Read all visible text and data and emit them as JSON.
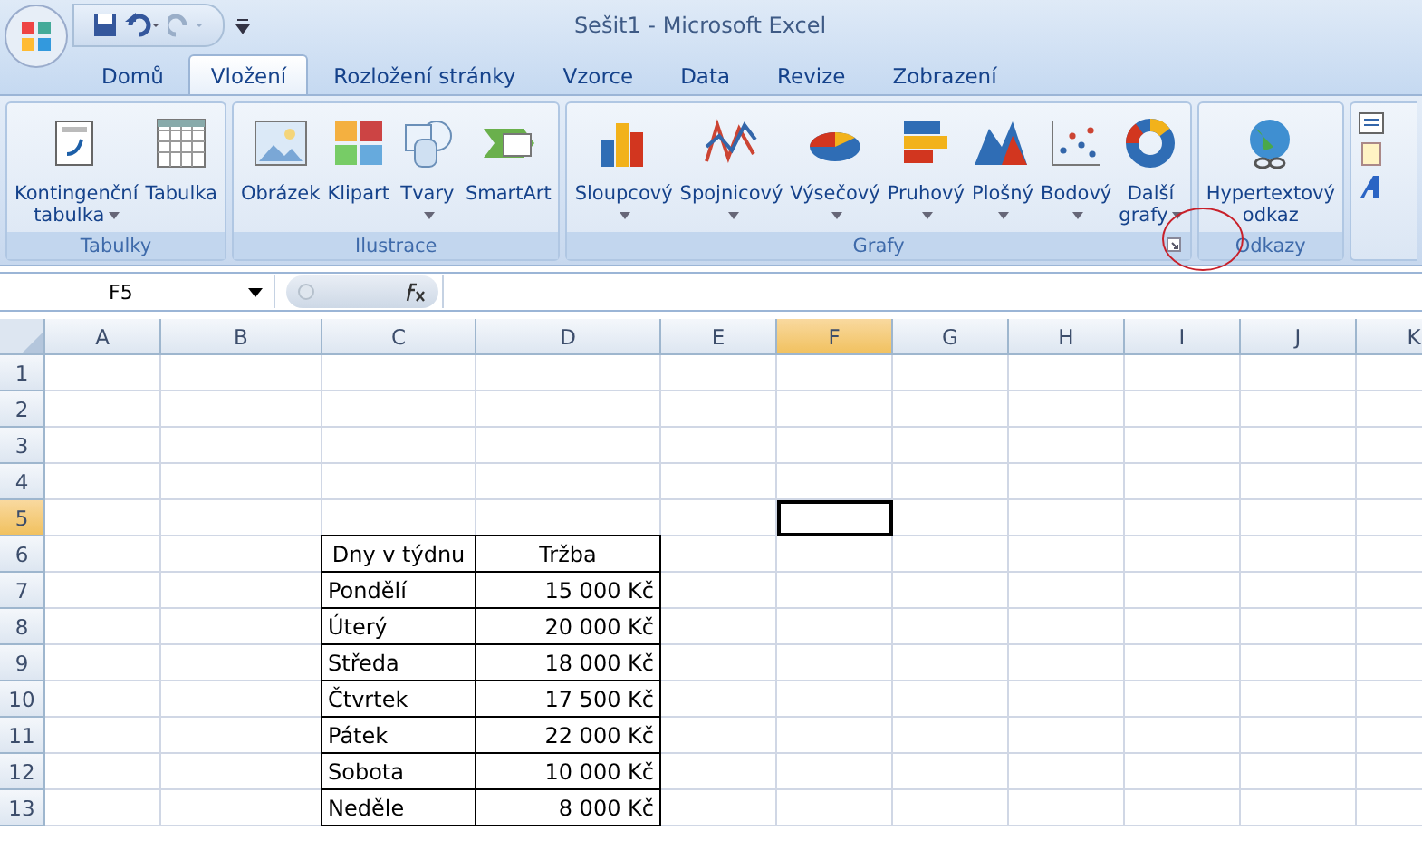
{
  "window": {
    "title": "Sešit1 - Microsoft Excel"
  },
  "tabs": [
    {
      "label": "Domů",
      "selected": false
    },
    {
      "label": "Vložení",
      "selected": true
    },
    {
      "label": "Rozložení stránky",
      "selected": false
    },
    {
      "label": "Vzorce",
      "selected": false
    },
    {
      "label": "Data",
      "selected": false
    },
    {
      "label": "Revize",
      "selected": false
    },
    {
      "label": "Zobrazení",
      "selected": false
    }
  ],
  "groups": [
    {
      "title": "Tabulky",
      "launcher": false,
      "buttons": [
        {
          "lines": [
            "Kontingenční",
            "tabulka"
          ],
          "dropdown": true
        },
        {
          "lines": [
            "Tabulka"
          ],
          "dropdown": false
        }
      ]
    },
    {
      "title": "Ilustrace",
      "launcher": false,
      "buttons": [
        {
          "lines": [
            "Obrázek"
          ],
          "dropdown": false
        },
        {
          "lines": [
            "Klipart"
          ],
          "dropdown": false
        },
        {
          "lines": [
            "Tvary"
          ],
          "dropdown": true
        },
        {
          "lines": [
            "SmartArt"
          ],
          "dropdown": false
        }
      ]
    },
    {
      "title": "Grafy",
      "launcher": true,
      "buttons": [
        {
          "lines": [
            "Sloupcový"
          ],
          "dropdown": true
        },
        {
          "lines": [
            "Spojnicový"
          ],
          "dropdown": true
        },
        {
          "lines": [
            "Výsečový"
          ],
          "dropdown": true
        },
        {
          "lines": [
            "Pruhový"
          ],
          "dropdown": true
        },
        {
          "lines": [
            "Plošný"
          ],
          "dropdown": true
        },
        {
          "lines": [
            "Bodový"
          ],
          "dropdown": true
        },
        {
          "lines": [
            "Další",
            "grafy"
          ],
          "dropdown": true
        }
      ]
    },
    {
      "title": "Odkazy",
      "launcher": false,
      "buttons": [
        {
          "lines": [
            "Hypertextový",
            "odkaz"
          ],
          "dropdown": false
        }
      ]
    }
  ],
  "name_box": "F5",
  "columns": [
    {
      "label": "A",
      "selected": false
    },
    {
      "label": "B",
      "selected": false
    },
    {
      "label": "C",
      "selected": false
    },
    {
      "label": "D",
      "selected": false
    },
    {
      "label": "E",
      "selected": false
    },
    {
      "label": "F",
      "selected": true
    },
    {
      "label": "G",
      "selected": false
    },
    {
      "label": "H",
      "selected": false
    },
    {
      "label": "I",
      "selected": false
    },
    {
      "label": "J",
      "selected": false
    },
    {
      "label": "K",
      "selected": false
    }
  ],
  "rows": [
    {
      "label": "1",
      "selected": false,
      "cells": []
    },
    {
      "label": "2",
      "selected": false,
      "cells": []
    },
    {
      "label": "3",
      "selected": false,
      "cells": []
    },
    {
      "label": "4",
      "selected": false,
      "cells": []
    },
    {
      "label": "5",
      "selected": true,
      "cells": []
    },
    {
      "label": "6",
      "selected": false,
      "cells": [
        {
          "kind": "heading",
          "text": "Dny v týdnu"
        },
        {
          "kind": "heading",
          "text": "Tržba"
        }
      ]
    },
    {
      "label": "7",
      "selected": false,
      "cells": [
        {
          "kind": "text",
          "text": "Pondělí"
        },
        {
          "kind": "amount",
          "text": "15 000 Kč"
        }
      ]
    },
    {
      "label": "8",
      "selected": false,
      "cells": [
        {
          "kind": "text",
          "text": "Úterý"
        },
        {
          "kind": "amount",
          "text": "20 000 Kč"
        }
      ]
    },
    {
      "label": "9",
      "selected": false,
      "cells": [
        {
          "kind": "text",
          "text": "Středa"
        },
        {
          "kind": "amount",
          "text": "18 000 Kč"
        }
      ]
    },
    {
      "label": "10",
      "selected": false,
      "cells": [
        {
          "kind": "text",
          "text": "Čtvrtek"
        },
        {
          "kind": "amount",
          "text": "17 500 Kč"
        }
      ]
    },
    {
      "label": "11",
      "selected": false,
      "cells": [
        {
          "kind": "text",
          "text": "Pátek"
        },
        {
          "kind": "amount",
          "text": "22 000 Kč"
        }
      ]
    },
    {
      "label": "12",
      "selected": false,
      "cells": [
        {
          "kind": "text",
          "text": "Sobota"
        },
        {
          "kind": "amount",
          "text": "10 000 Kč"
        }
      ]
    },
    {
      "label": "13",
      "selected": false,
      "cells": [
        {
          "kind": "text",
          "text": "Neděle"
        },
        {
          "kind": "amount",
          "text": "8 000 Kč"
        }
      ]
    }
  ]
}
